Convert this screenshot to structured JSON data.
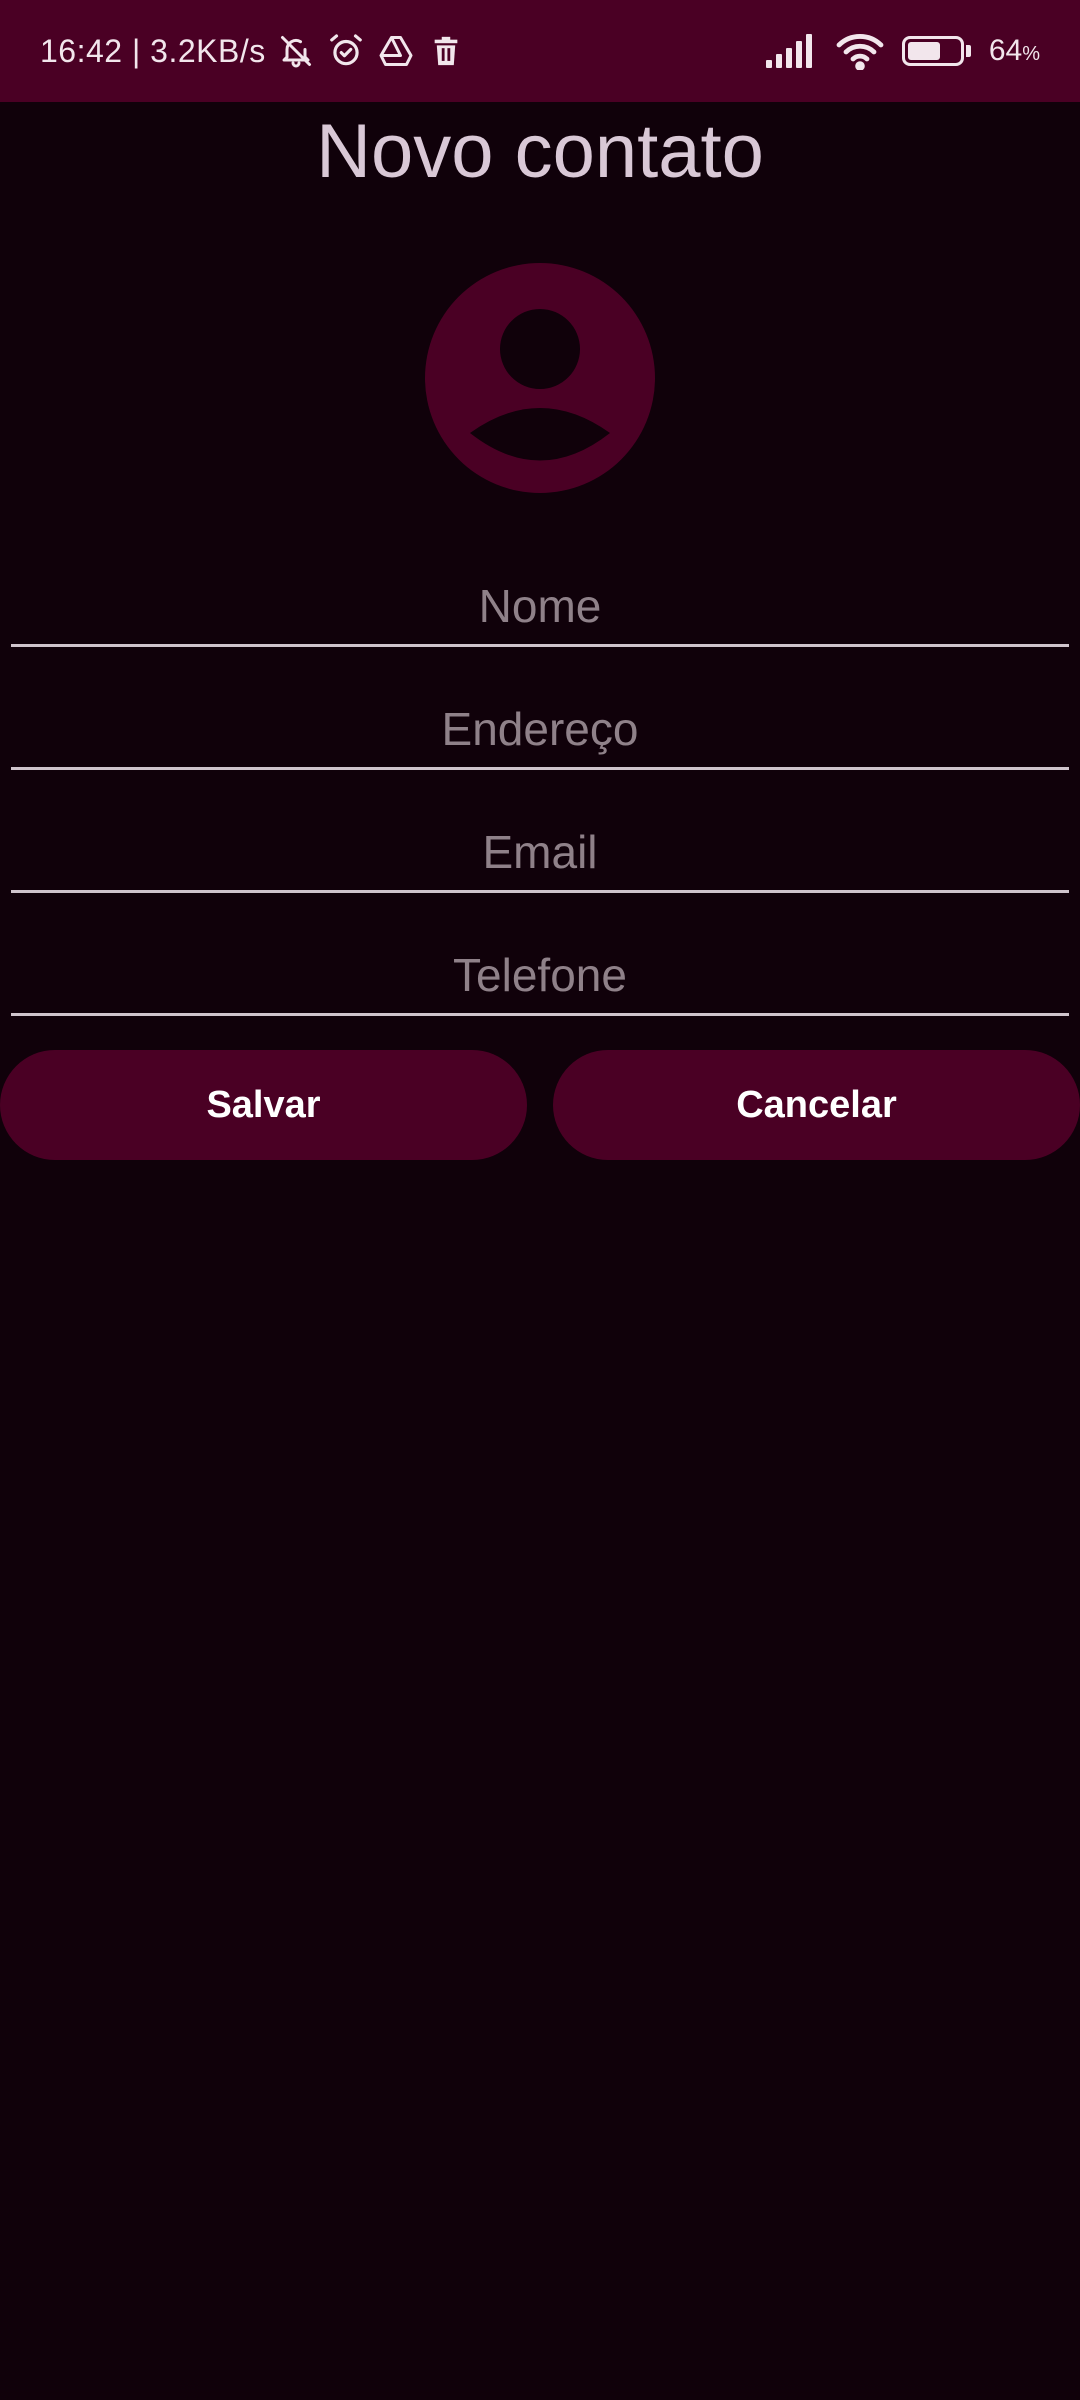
{
  "status_bar": {
    "time_speed": "16:42 | 3.2KB/s",
    "icons": [
      "bell-off-icon",
      "alarm-icon",
      "drive-icon",
      "trash-icon"
    ],
    "right_icons": [
      "signal-icon",
      "wifi-icon",
      "battery-icon"
    ],
    "battery_level": 0.64,
    "battery_value": "64",
    "battery_unit": "%"
  },
  "page": {
    "title": "Novo contato"
  },
  "form": {
    "name_placeholder": "Nome",
    "address_placeholder": "Endereço",
    "email_placeholder": "Email",
    "phone_placeholder": "Telefone"
  },
  "actions": {
    "save_label": "Salvar",
    "cancel_label": "Cancelar"
  },
  "colors": {
    "background": "#10010a",
    "accent": "#4a0024",
    "title_text": "#d9c8d6",
    "placeholder_text": "#8f8189",
    "underline": "#cfc4cc"
  }
}
